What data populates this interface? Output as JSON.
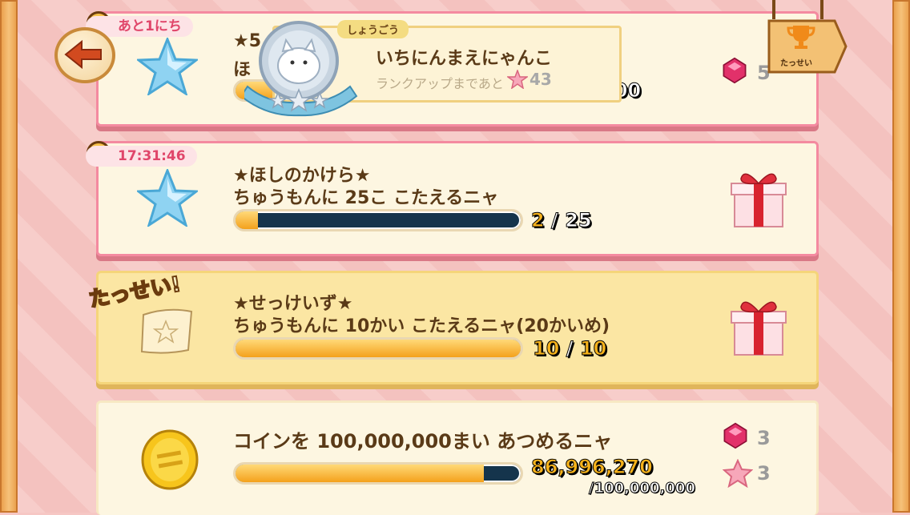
{
  "header": {
    "back_label": "back",
    "achievement_sign": "たっせい"
  },
  "rank_popup": {
    "badge": "しょうごう",
    "rank_name": "いちにんまえにゃんこ",
    "until_label": "ランクアップまであと",
    "until_value": "43"
  },
  "missions": [
    {
      "timer": "あと1にち",
      "title_partial": "★5",
      "title_line2_partial": "ほ",
      "progress_partial": ",000",
      "reward_count": "5"
    },
    {
      "timer": "17:31:46",
      "title": "★ほしのかけら★",
      "desc": "ちゅうもんに 25こ こたえるニャ",
      "current": "2",
      "sep": " / ",
      "total": "25",
      "fill": 0.08
    },
    {
      "status": "たっせい!",
      "title": "★せっけいず★",
      "desc": "ちゅうもんに 10かい こたえるニャ(20かいめ)",
      "current": "10",
      "sep": " / ",
      "total": "10",
      "fill": 1.0
    },
    {
      "title": "コインを 100,000,000まい あつめるニャ",
      "current": "86,996,270",
      "total": "/100,000,000",
      "fill": 0.87,
      "reward_gems": "3",
      "reward_stars": "3"
    }
  ],
  "colors": {
    "pink_border": "#f48aa0",
    "gold": "#f6b21b",
    "bar_dark": "#15344c"
  }
}
